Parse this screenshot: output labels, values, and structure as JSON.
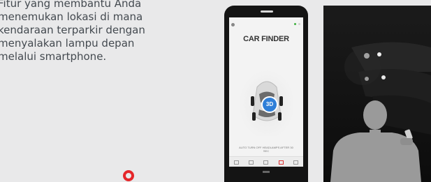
{
  "description": {
    "lines": [
      "Fitur yang membantu Anda",
      "menemukan lokasi di mana",
      "kendaraan terparkir dengan",
      "menyalakan lampu depan",
      "melalui smartphone."
    ]
  },
  "app": {
    "title": "CAR FINDER",
    "button_label": "3D",
    "hint": "AUTO TURN OFF HEADLAMPS AFTER 30 SEC",
    "tabs": [
      "car-icon",
      "door-icon",
      "lights-icon",
      "battery-icon",
      "bell-icon"
    ],
    "active_tab": 3
  },
  "colors": {
    "accent": "#2f7fd8",
    "pin": "#e5262a"
  }
}
